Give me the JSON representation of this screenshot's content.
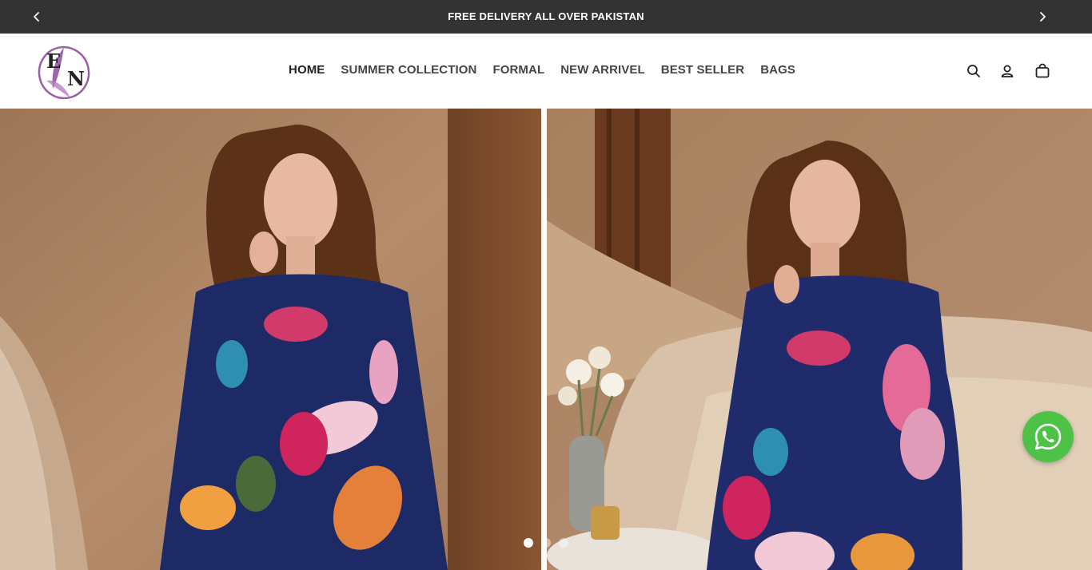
{
  "announcement": {
    "message": "FREE DELIVERY ALL OVER PAKISTAN",
    "prev_icon": "chevron-left-icon",
    "next_icon": "chevron-right-icon"
  },
  "header": {
    "logo_text": "EN",
    "nav": [
      {
        "label": "HOME",
        "active": true
      },
      {
        "label": "SUMMER COLLECTION",
        "active": false
      },
      {
        "label": "FORMAL",
        "active": false
      },
      {
        "label": "NEW ARRIVEL",
        "active": false
      },
      {
        "label": "BEST SELLER",
        "active": false
      },
      {
        "label": "BAGS",
        "active": false
      }
    ],
    "icons": [
      "search-icon",
      "account-icon",
      "cart-icon"
    ]
  },
  "hero": {
    "slides": 3,
    "active_slide": 1
  },
  "colors": {
    "announcement_bg": "#333333",
    "whatsapp_green": "#4dc247",
    "logo_purple": "#9b5fa6"
  },
  "floating": {
    "whatsapp_icon": "whatsapp-icon"
  }
}
